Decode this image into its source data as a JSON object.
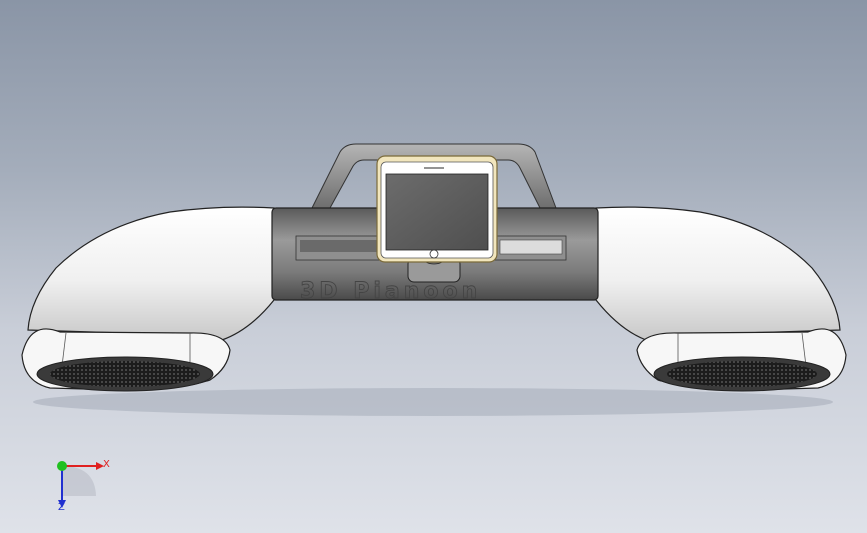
{
  "viewport": {
    "background_top": "#8a95a6",
    "background_bottom": "#dfe2e9"
  },
  "model": {
    "embossed_text": "3D Pianoon",
    "shell_color": "#f4f4f4",
    "body_color": "#7a7a7a",
    "phone_screen_color": "#5f5f5f",
    "phone_frame_color": "#e8d7a0"
  },
  "triad": {
    "x_label": "X",
    "z_label": "Z",
    "x_color": "#e02020",
    "y_color": "#20c020",
    "z_color": "#2030d0"
  }
}
